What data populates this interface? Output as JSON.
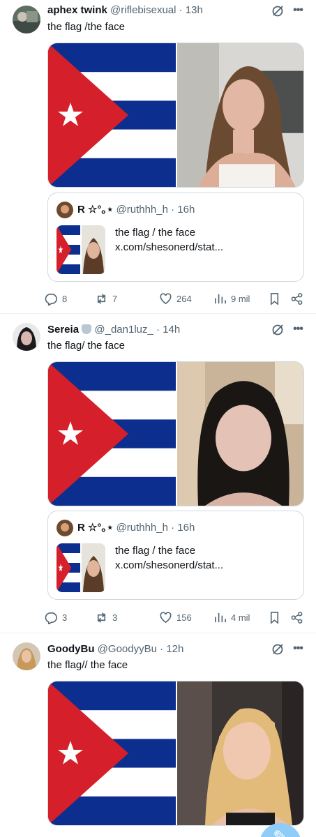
{
  "tweets": [
    {
      "name": "aphex twink",
      "handle": "@riflebisexual",
      "time": "· 13h",
      "text": "the flag /the face",
      "quote": {
        "name": "R ☆°｡⋆",
        "handle": "@ruthhh_h",
        "time": "· 16h",
        "text": "the flag / the face",
        "link": "x.com/shesonerd/stat..."
      },
      "replies": "8",
      "reposts": "7",
      "likes": "264",
      "views": "9 mil"
    },
    {
      "name": "Sereia",
      "handle": "@_dan1luz_",
      "time": "· 14h",
      "text": "the flag/ the face",
      "quote": {
        "name": "R ☆°｡⋆",
        "handle": "@ruthhh_h",
        "time": "· 16h",
        "text": "the flag / the face",
        "link": "x.com/shesonerd/stat..."
      },
      "replies": "3",
      "reposts": "3",
      "likes": "156",
      "views": "4 mil"
    },
    {
      "name": "GoodyBu",
      "handle": "@GoodyyBu",
      "time": "· 12h",
      "text": "the flag// the face"
    }
  ],
  "icons": {
    "grok": "grok-icon",
    "more": "more-icon",
    "reply": "reply-icon",
    "repost": "repost-icon",
    "like": "heart-icon",
    "views": "views-icon",
    "bookmark": "bookmark-icon",
    "share": "share-icon",
    "compose": "compose-icon"
  },
  "colors": {
    "flag_blue": "#0c2f8f",
    "flag_red": "#d51f2a",
    "text": "#0f1419",
    "muted": "#536471",
    "border": "#cfd9de"
  }
}
